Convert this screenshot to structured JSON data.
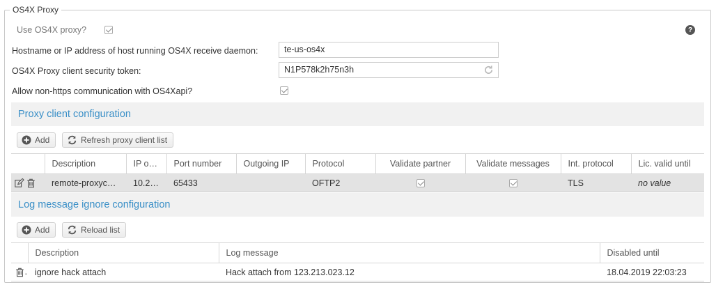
{
  "fieldset": {
    "legend": "OS4X Proxy"
  },
  "use_proxy": {
    "label": "Use OS4X proxy?",
    "checked": true
  },
  "hostname": {
    "label": "Hostname or IP address of host running OS4X receive daemon:",
    "value": "te-us-os4x"
  },
  "token": {
    "label": "OS4X Proxy client security token:",
    "value": "N1P578k2h75n3h"
  },
  "non_https": {
    "label": "Allow non-https communication with OS4Xapi?",
    "checked": true
  },
  "help_icon": "question-icon",
  "proxy_section": {
    "title": "Proxy client configuration",
    "add_label": "Add",
    "refresh_label": "Refresh proxy client list",
    "columns": [
      "Description",
      "IP o…",
      "Port number",
      "Outgoing IP",
      "Protocol",
      "Validate partner",
      "Validate messages",
      "Int. protocol",
      "Lic. valid until"
    ],
    "rows": [
      {
        "description": "remote-proxyc…",
        "ip": "10.2…",
        "port": "65433",
        "outgoing_ip": "",
        "protocol": "OFTP2",
        "validate_partner": true,
        "validate_messages": true,
        "int_protocol": "TLS",
        "lic_valid_until": "no value"
      }
    ]
  },
  "log_section": {
    "title": "Log message ignore configuration",
    "add_label": "Add",
    "reload_label": "Reload list",
    "columns": [
      "Description",
      "Log message",
      "Disabled until"
    ],
    "rows": [
      {
        "description": "ignore hack attach",
        "log_message": "Hack attach from 123.213.023.12",
        "disabled_until": "18.04.2019 22:03:23"
      }
    ]
  },
  "colors": {
    "accent": "#3a8fc7",
    "section_bg": "#f1f1f1",
    "selected_row": "#e3e3e3"
  }
}
